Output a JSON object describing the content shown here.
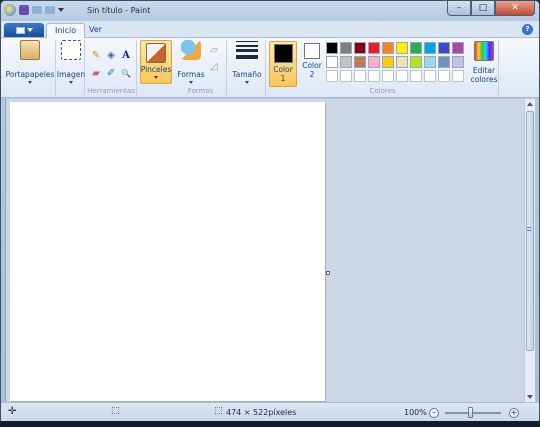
{
  "window": {
    "title": "Sin título - Paint",
    "minimize": "–",
    "maximize": "□",
    "close": "✕"
  },
  "tabs": {
    "home": "Inicio",
    "view": "Ver",
    "help": "?"
  },
  "ribbon": {
    "clipboard": "Portapapeles",
    "image": "Imagen",
    "tools_group": "Herramientas",
    "brushes": "Pinceles",
    "shapes": "Formas",
    "shapes_group": "Formas",
    "size": "Tamaño",
    "color1_label": "Color",
    "color1_num": "1",
    "color2_label": "Color",
    "color2_num": "2",
    "edit_colors_1": "Editar",
    "edit_colors_2": "colores",
    "colors_group": "Colores",
    "text_tool": "A",
    "magnifier": "🔍"
  },
  "colors": {
    "color1": "#000000",
    "color2": "#ffffff",
    "palette_row1": [
      "#000000",
      "#7f7f7f",
      "#880015",
      "#ed1c24",
      "#ff7f27",
      "#fff200",
      "#22b14c",
      "#00a2e8",
      "#3f48cc",
      "#a349a4"
    ],
    "palette_row2": [
      "#ffffff",
      "#c3c3c3",
      "#b97a57",
      "#ffaec9",
      "#ffc90e",
      "#efe4b0",
      "#b5e61d",
      "#99d9ea",
      "#7092be",
      "#c8bfe7"
    ],
    "palette_row3": [
      "#ffffff",
      "#ffffff",
      "#ffffff",
      "#ffffff",
      "#ffffff",
      "#ffffff",
      "#ffffff",
      "#ffffff",
      "#ffffff",
      "#ffffff"
    ]
  },
  "status": {
    "canvas_size": "474 × 522píxeles",
    "zoom": "100%",
    "zoom_out": "–",
    "zoom_in": "+"
  }
}
